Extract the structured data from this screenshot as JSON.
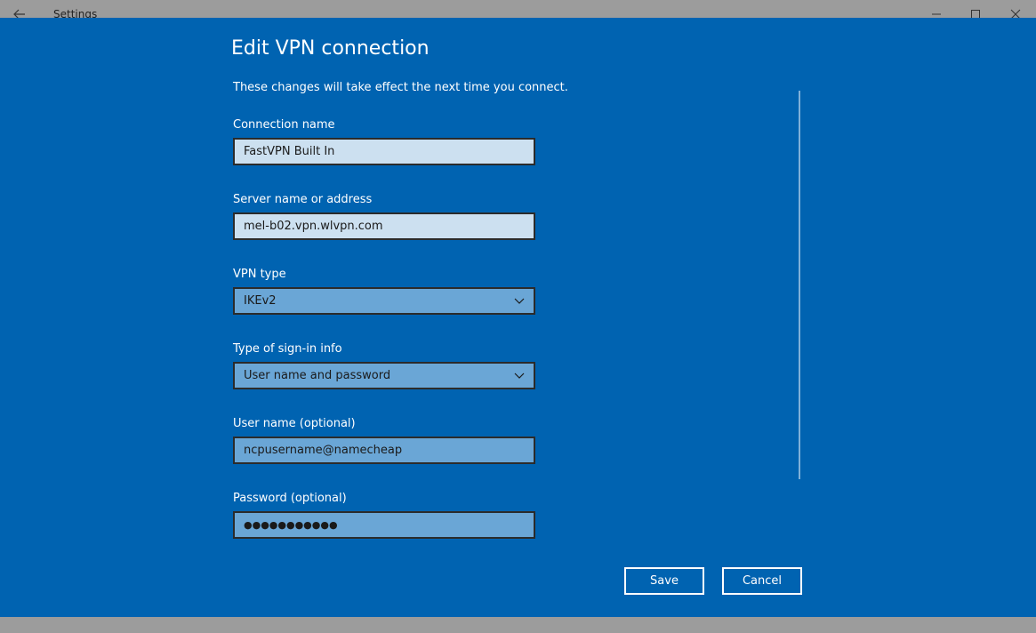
{
  "window": {
    "title": "Settings",
    "back_icon": "back-arrow-icon",
    "minimize_icon": "minimize-icon",
    "maximize_icon": "maximize-icon",
    "close_icon": "close-icon"
  },
  "dialog": {
    "heading": "Edit VPN connection",
    "subtext": "These changes will take effect the next time you connect.",
    "fields": {
      "connection_name": {
        "label": "Connection name",
        "value": "FastVPN Built In"
      },
      "server": {
        "label": "Server name or address",
        "value": "mel-b02.vpn.wlvpn.com"
      },
      "vpn_type": {
        "label": "VPN type",
        "value": "IKEv2"
      },
      "signin_type": {
        "label": "Type of sign-in info",
        "value": "User name and password"
      },
      "username": {
        "label": "User name (optional)",
        "value": "ncpusername@namecheap"
      },
      "password": {
        "label": "Password (optional)",
        "value": "●●●●●●●●●●●"
      }
    },
    "buttons": {
      "save": "Save",
      "cancel": "Cancel"
    }
  },
  "colors": {
    "accent": "#0063b1",
    "field_light": "#cce0f0",
    "field_mid": "#6aa6d6",
    "chrome": "#9c9c9c"
  }
}
